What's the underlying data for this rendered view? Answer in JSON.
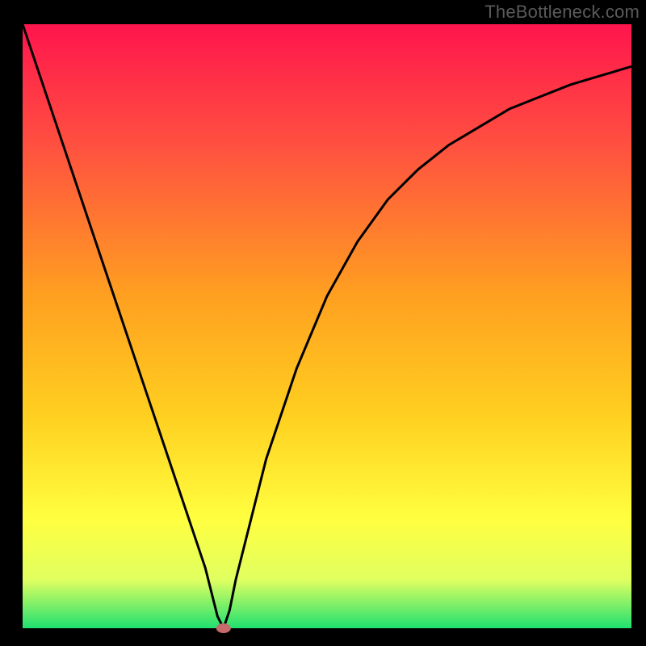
{
  "watermark": "TheBottleneck.com",
  "chart_data": {
    "type": "line",
    "title": "",
    "xlabel": "",
    "ylabel": "",
    "xlim": [
      0,
      100
    ],
    "ylim": [
      0,
      100
    ],
    "grid": false,
    "categories": [
      0,
      5,
      10,
      15,
      20,
      25,
      30,
      32,
      33,
      34,
      35,
      40,
      45,
      50,
      55,
      60,
      65,
      70,
      75,
      80,
      85,
      90,
      95,
      100
    ],
    "series": [
      {
        "name": "bottleneck-curve",
        "values": [
          100,
          85,
          70,
          55,
          40,
          25,
          10,
          2,
          0,
          3,
          8,
          28,
          43,
          55,
          64,
          71,
          76,
          80,
          83,
          86,
          88,
          90,
          91.5,
          93
        ]
      }
    ],
    "marker": {
      "x": 33,
      "y": 0
    },
    "gradient_stops": [
      {
        "offset": 0,
        "color": "#ff154d"
      },
      {
        "offset": 20,
        "color": "#ff5040"
      },
      {
        "offset": 45,
        "color": "#ffa020"
      },
      {
        "offset": 65,
        "color": "#ffd020"
      },
      {
        "offset": 82,
        "color": "#ffff40"
      },
      {
        "offset": 92,
        "color": "#e0ff60"
      },
      {
        "offset": 100,
        "color": "#20e070"
      }
    ],
    "curve_color": "#000000",
    "marker_color": "#c86a6a",
    "frame_color": "#000000"
  }
}
